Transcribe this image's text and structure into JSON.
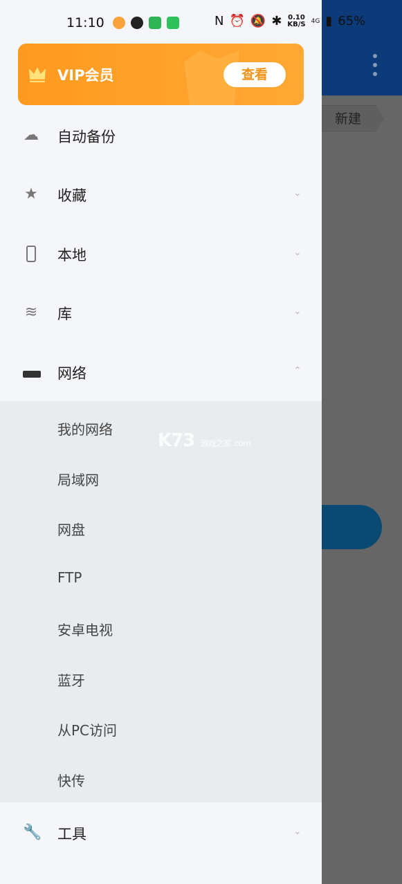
{
  "status_bar": {
    "time": "11:10",
    "speed": "0.10",
    "speed_unit": "KB/S",
    "network": "4G",
    "battery": "65%"
  },
  "background": {
    "breadcrumb": "新建",
    "topbar_color": "#0d3a78"
  },
  "vip": {
    "title": "VIP会员",
    "button": "查看",
    "color": "#ff9a1f"
  },
  "menu": [
    {
      "label": "自动备份",
      "icon": "cloud-sync-icon",
      "chevron": ""
    },
    {
      "label": "收藏",
      "icon": "star-icon",
      "chevron": "down"
    },
    {
      "label": "本地",
      "icon": "phone-icon",
      "chevron": "down"
    },
    {
      "label": "库",
      "icon": "layers-icon",
      "chevron": "down"
    },
    {
      "label": "网络",
      "icon": "router-icon",
      "chevron": "up"
    }
  ],
  "network_sub": [
    "我的网络",
    "局域网",
    "网盘",
    "FTP",
    "安卓电视",
    "蓝牙",
    "从PC访问",
    "快传"
  ],
  "tools": {
    "label": "工具",
    "icon": "wrench-icon",
    "chevron": "down"
  },
  "watermark": {
    "text": "K73",
    "sub": "游戏之家 .com"
  }
}
